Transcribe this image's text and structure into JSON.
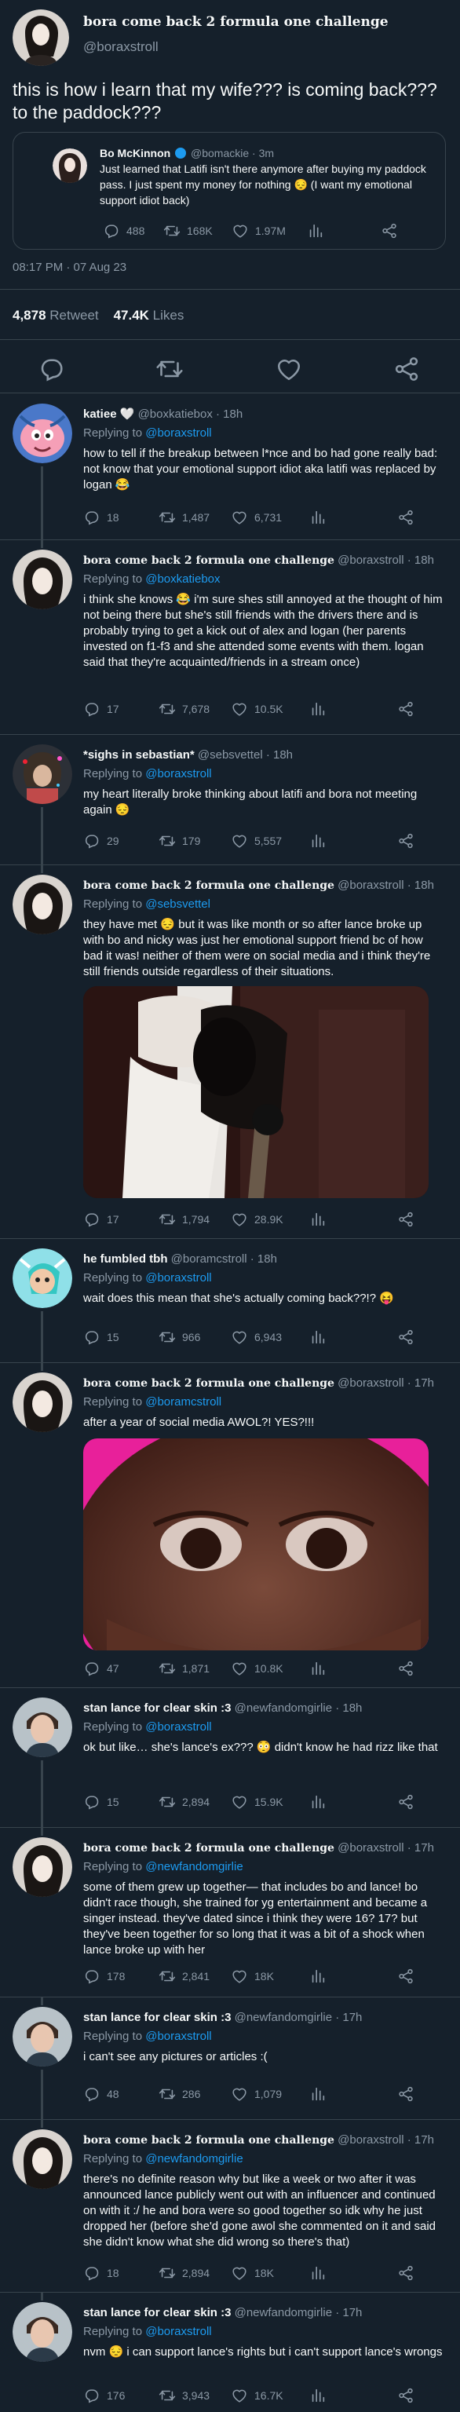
{
  "main": {
    "name": "bora come back 2 formula one challenge",
    "handle": "@boraxstroll",
    "text": "this is how i learn that my wife??? is coming back??? to the paddock???",
    "quote": {
      "name": "Bo McKinnon",
      "handle": "@bomackie · 3m",
      "text": "Just learned that Latifi isn't there anymore after buying my paddock pass. I just spent my money for nothing 😔 (I want my emotional support idiot back)",
      "replies": "488",
      "retweets": "168K",
      "likes": "1.97M"
    },
    "timestamp": "08:17 PM · 07 Aug 23",
    "retweet_count": "4,878",
    "retweet_label": "Retweet",
    "like_count": "47.4K",
    "like_label": "Likes"
  },
  "replies": [
    {
      "name": "katiee 🤍",
      "handle": "@boxkatiebox · 18h",
      "replying_label": "Replying to",
      "replying_to": "@boraxstroll",
      "text": "how to tell if the breakup between l*nce and bo had gone really bad: not know that your emotional support idiot aka latifi was replaced by logan 😂",
      "replies": "18",
      "retweets": "1,487",
      "likes": "6,731"
    },
    {
      "name": "bora come back 2 formula one challenge",
      "handle": "@boraxstroll · 18h",
      "replying_label": "Replying to",
      "replying_to": "@boxkatiebox",
      "text": "i think she knows 😂 i'm sure shes still annoyed at the thought of him not being there but she's still friends with the drivers there and is probably trying to get a kick out of alex and logan (her parents invested on f1-f3 and she attended some events with them. logan said that they're acquainted/friends in a stream once)",
      "replies": "17",
      "retweets": "7,678",
      "likes": "10.5K"
    },
    {
      "name": "*sighs in sebastian*",
      "handle": "@sebsvettel · 18h",
      "replying_label": "Replying to",
      "replying_to": "@boraxstroll",
      "text": "my heart literally broke thinking about latifi and bora not meeting again 😔",
      "replies": "29",
      "retweets": "179",
      "likes": "5,557"
    },
    {
      "name": "bora come back 2 formula one challenge",
      "handle": "@boraxstroll · 18h",
      "replying_label": "Replying to",
      "replying_to": "@sebsvettel",
      "text": "they have met 😔 but it was like month or so after lance broke up with bo and nicky was just her emotional support friend bc of how bad it was! neither of them were on social media and i think they're still friends outside regardless of their situations.",
      "replies": "17",
      "retweets": "1,794",
      "likes": "28.9K"
    },
    {
      "name": "he fumbled tbh",
      "handle": "@boramcstroll · 18h",
      "replying_label": "Replying to",
      "replying_to": "@boraxstroll",
      "text": "wait does this mean that she's actually coming back??!? 😝",
      "replies": "15",
      "retweets": "966",
      "likes": "6,943"
    },
    {
      "name": "bora come back 2 formula one challenge",
      "handle": "@boraxstroll · 17h",
      "replying_label": "Replying to",
      "replying_to": "@boramcstroll",
      "text": "after a year of social media AWOL?! YES?!!!",
      "replies": "47",
      "retweets": "1,871",
      "likes": "10.8K"
    },
    {
      "name": "stan lance for clear skin :3",
      "handle": "@newfandomgirlie · 18h",
      "replying_label": "Replying to",
      "replying_to": "@boraxstroll",
      "text": "ok but like… she's lance's ex??? 😳 didn't know he had rizz like that",
      "replies": "15",
      "retweets": "2,894",
      "likes": "15.9K"
    },
    {
      "name": "bora come back 2 formula one challenge",
      "handle": "@boraxstroll · 17h",
      "replying_label": "Replying to",
      "replying_to": "@newfandomgirlie",
      "text": "some of them grew up together— that includes bo and lance! bo didn't race though, she trained for yg entertainment and became a singer instead. they've dated since i think they were 16? 17? but they've been together for so long that it was a bit of a shock when lance broke up with her",
      "replies": "178",
      "retweets": "2,841",
      "likes": "18K"
    },
    {
      "name": "stan lance for clear skin :3",
      "handle": "@newfandomgirlie · 17h",
      "replying_label": "Replying to",
      "replying_to": "@boraxstroll",
      "text": "i can't see any pictures or articles :(",
      "replies": "48",
      "retweets": "286",
      "likes": "1,079"
    },
    {
      "name": "bora come back 2 formula one challenge",
      "handle": "@boraxstroll · 17h",
      "replying_label": "Replying to",
      "replying_to": "@newfandomgirlie",
      "text": "there's no definite reason why but like a week or two after it was announced lance publicly went out with an influencer and continued on with it :/ he and bora were so good together so idk why he just dropped her (before she'd gone awol she commented on it and said she didn't know what she did wrong so there's that)",
      "replies": "18",
      "retweets": "2,894",
      "likes": "18K"
    },
    {
      "name": "stan lance for clear skin :3",
      "handle": "@newfandomgirlie · 17h",
      "replying_label": "Replying to",
      "replying_to": "@boraxstroll",
      "text": "nvm 😔 i can support lance's rights but i can't support lance's wrongs",
      "replies": "176",
      "retweets": "3,943",
      "likes": "16.7K"
    }
  ],
  "colors": {
    "bg": "#15202b",
    "text": "#f7f9f9",
    "muted": "#8b98a5",
    "accent": "#1d9bf0",
    "border": "#38444d"
  }
}
